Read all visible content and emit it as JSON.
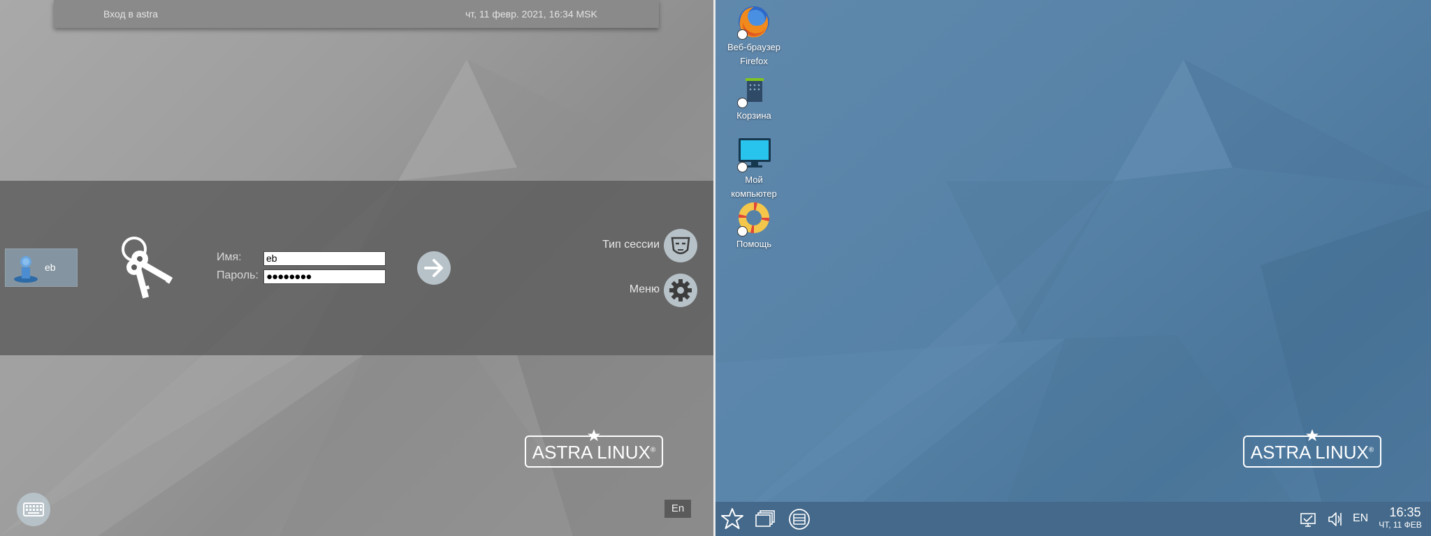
{
  "login": {
    "topbar": {
      "title": "Вход в astra",
      "datetime": "чт, 11 февр. 2021, 16:34 MSK"
    },
    "user": {
      "name": "eb",
      "icon": "user-icon"
    },
    "form": {
      "name_label": "Имя:",
      "name_value": "eb",
      "password_label": "Пароль:",
      "password_mask": "●●●●●●●●"
    },
    "session": {
      "label": "Тип сессии",
      "icon": "mask-icon"
    },
    "menu": {
      "label": "Меню",
      "icon": "gear-icon"
    },
    "logo": {
      "text": "ASTRA LINUX",
      "mark": "®"
    },
    "keyboard": {
      "icon": "keyboard-icon"
    },
    "language": "En"
  },
  "desktop": {
    "icons": [
      {
        "label_line1": "Веб-браузер",
        "label_line2": "Firefox",
        "icon": "firefox-icon"
      },
      {
        "label_line1": "Корзина",
        "label_line2": "",
        "icon": "trash-icon"
      },
      {
        "label_line1": "Мой",
        "label_line2": "компьютер",
        "icon": "computer-icon"
      },
      {
        "label_line1": "Помощь",
        "label_line2": "",
        "icon": "help-lifebuoy-icon"
      }
    ],
    "logo": {
      "text": "ASTRA LINUX",
      "mark": "®"
    },
    "taskbar": {
      "start_icon": "star-icon",
      "windows_icon": "windows-icon",
      "files_icon": "file-manager-icon",
      "network_icon": "network-icon",
      "volume_icon": "volume-icon",
      "language": "EN",
      "time": "16:35",
      "date": "ЧТ, 11 ФЕВ"
    }
  },
  "colors": {
    "login_bg": "#9d9d9d",
    "desktop_bg": "#5782a7",
    "taskbar_bg": "#45698a",
    "button_bg": "#b7c2c8"
  }
}
